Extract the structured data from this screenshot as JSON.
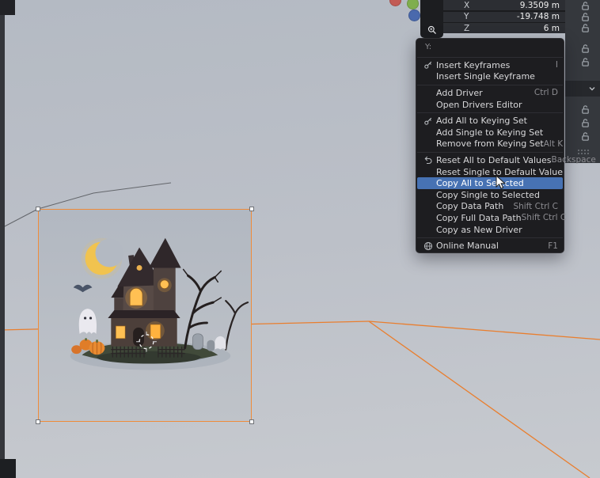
{
  "transform_fields": {
    "rows": [
      {
        "label": "X",
        "value": "9.3509 m"
      },
      {
        "label": "Y",
        "value": "-19.748 m"
      },
      {
        "label": "Z",
        "value": "6 m"
      }
    ]
  },
  "context_menu": {
    "header": "Y:",
    "items": [
      {
        "label": "Insert Keyframes",
        "shortcut": "I"
      },
      {
        "label": "Insert Single Keyframe",
        "shortcut": ""
      },
      {
        "label": "Add Driver",
        "shortcut": "Ctrl D"
      },
      {
        "label": "Open Drivers Editor",
        "shortcut": ""
      },
      {
        "label": "Add All to Keying Set",
        "shortcut": ""
      },
      {
        "label": "Add Single to Keying Set",
        "shortcut": ""
      },
      {
        "label": "Remove from Keying Set",
        "shortcut": "Alt K"
      },
      {
        "label": "Reset All to Default Values",
        "shortcut": "Backspace"
      },
      {
        "label": "Reset Single to Default Value",
        "shortcut": ""
      },
      {
        "label": "Copy All to Selected",
        "shortcut": "",
        "highlighted": true
      },
      {
        "label": "Copy Single to Selected",
        "shortcut": ""
      },
      {
        "label": "Copy Data Path",
        "shortcut": "Shift Ctrl C"
      },
      {
        "label": "Copy Full Data Path",
        "shortcut": "Shift Ctrl C"
      },
      {
        "label": "Copy as New Driver",
        "shortcut": ""
      },
      {
        "label": "Online Manual",
        "shortcut": "F1"
      }
    ]
  },
  "icons": {
    "key-icon": "key glyph for keyframe/keying-set rows",
    "undo-icon": "loop-back arrow for reset row",
    "globe-icon": "globe for online manual",
    "lock-open-icon": "open padlock per axis row",
    "chevron-down-icon": "collapsed dropdown arrow",
    "grip-icon": "panel drag dots",
    "magnifier-icon": "viewport zoom control",
    "cursor-icon": "mouse arrow pointer"
  },
  "colors": {
    "menu_bg": "#1d1d20",
    "menu_highlight": "#4772b3",
    "selection_outline": "#ef8b3a",
    "wire_orange": "#e97e2e",
    "axis_x": "#c25b55",
    "axis_y": "#7fae4e",
    "axis_z": "#4a69ad"
  }
}
